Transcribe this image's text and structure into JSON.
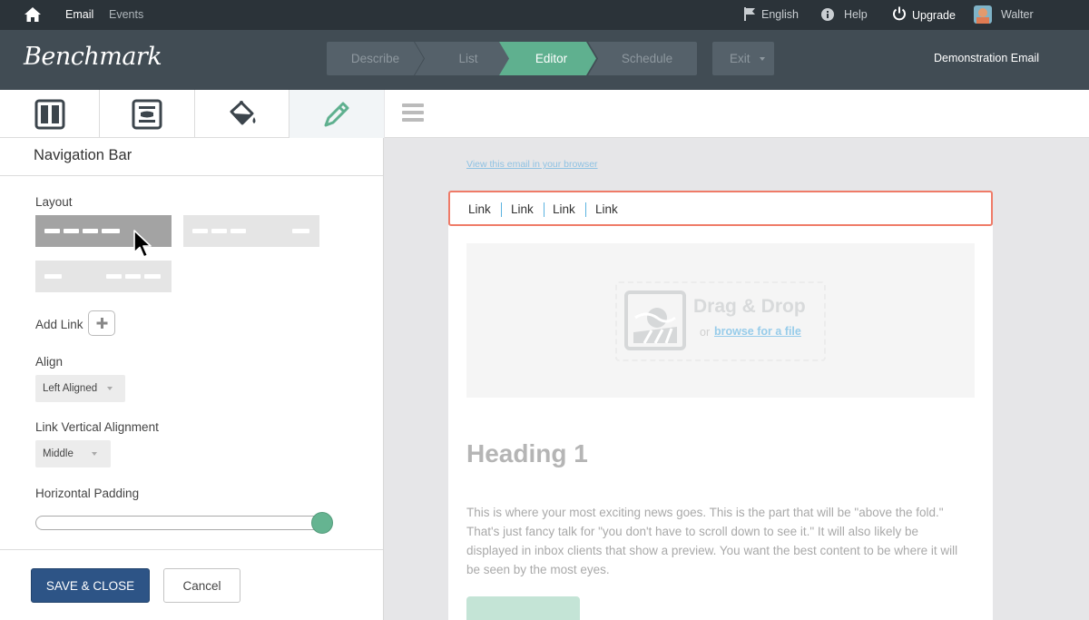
{
  "topbar": {
    "home_icon": "home-icon",
    "nav_email": "Email",
    "nav_events": "Events",
    "language": "English",
    "help": "Help",
    "upgrade": "Upgrade",
    "user": "Walter"
  },
  "header": {
    "logo": "Benchmark",
    "steps": [
      {
        "label": "Describe",
        "active": false
      },
      {
        "label": "List",
        "active": false
      },
      {
        "label": "Editor",
        "active": true
      },
      {
        "label": "Schedule",
        "active": false
      }
    ],
    "exit_label": "Exit",
    "email_name": "Demonstration Email"
  },
  "tool_tabs": [
    {
      "icon": "layout-columns-icon",
      "active": false
    },
    {
      "icon": "content-block-icon",
      "active": false
    },
    {
      "icon": "paint-bucket-icon",
      "active": false
    },
    {
      "icon": "pencil-icon",
      "active": true
    }
  ],
  "panel": {
    "title": "Navigation Bar",
    "layout_label": "Layout",
    "add_link_label": "Add Link",
    "align_label": "Align",
    "align_value": "Left Aligned",
    "vertical_label": "Link Vertical Alignment",
    "vertical_value": "Middle",
    "padding_label": "Horizontal Padding",
    "padding_level": 1.0,
    "save_label": "SAVE & CLOSE",
    "cancel_label": "Cancel"
  },
  "canvas": {
    "view_in_browser": "View this email in your browser",
    "nav_links": [
      "Link",
      "Link",
      "Link",
      "Link"
    ],
    "dnd_title": "Drag & Drop",
    "dnd_or": "or",
    "dnd_browse": "browse for a file",
    "heading": "Heading 1",
    "paragraph": "This is where your most exciting news goes. This is the part that will be \"above the fold.\" That's just fancy talk for \"you don't have to scroll down to see it.\" It will also likely be displayed in inbox clients that show a preview. You want the best content to be where it will be seen by the most eyes."
  },
  "colors": {
    "accent": "#5fb08f",
    "primary_button": "#2d5486",
    "selection_border": "#ef7b68"
  }
}
